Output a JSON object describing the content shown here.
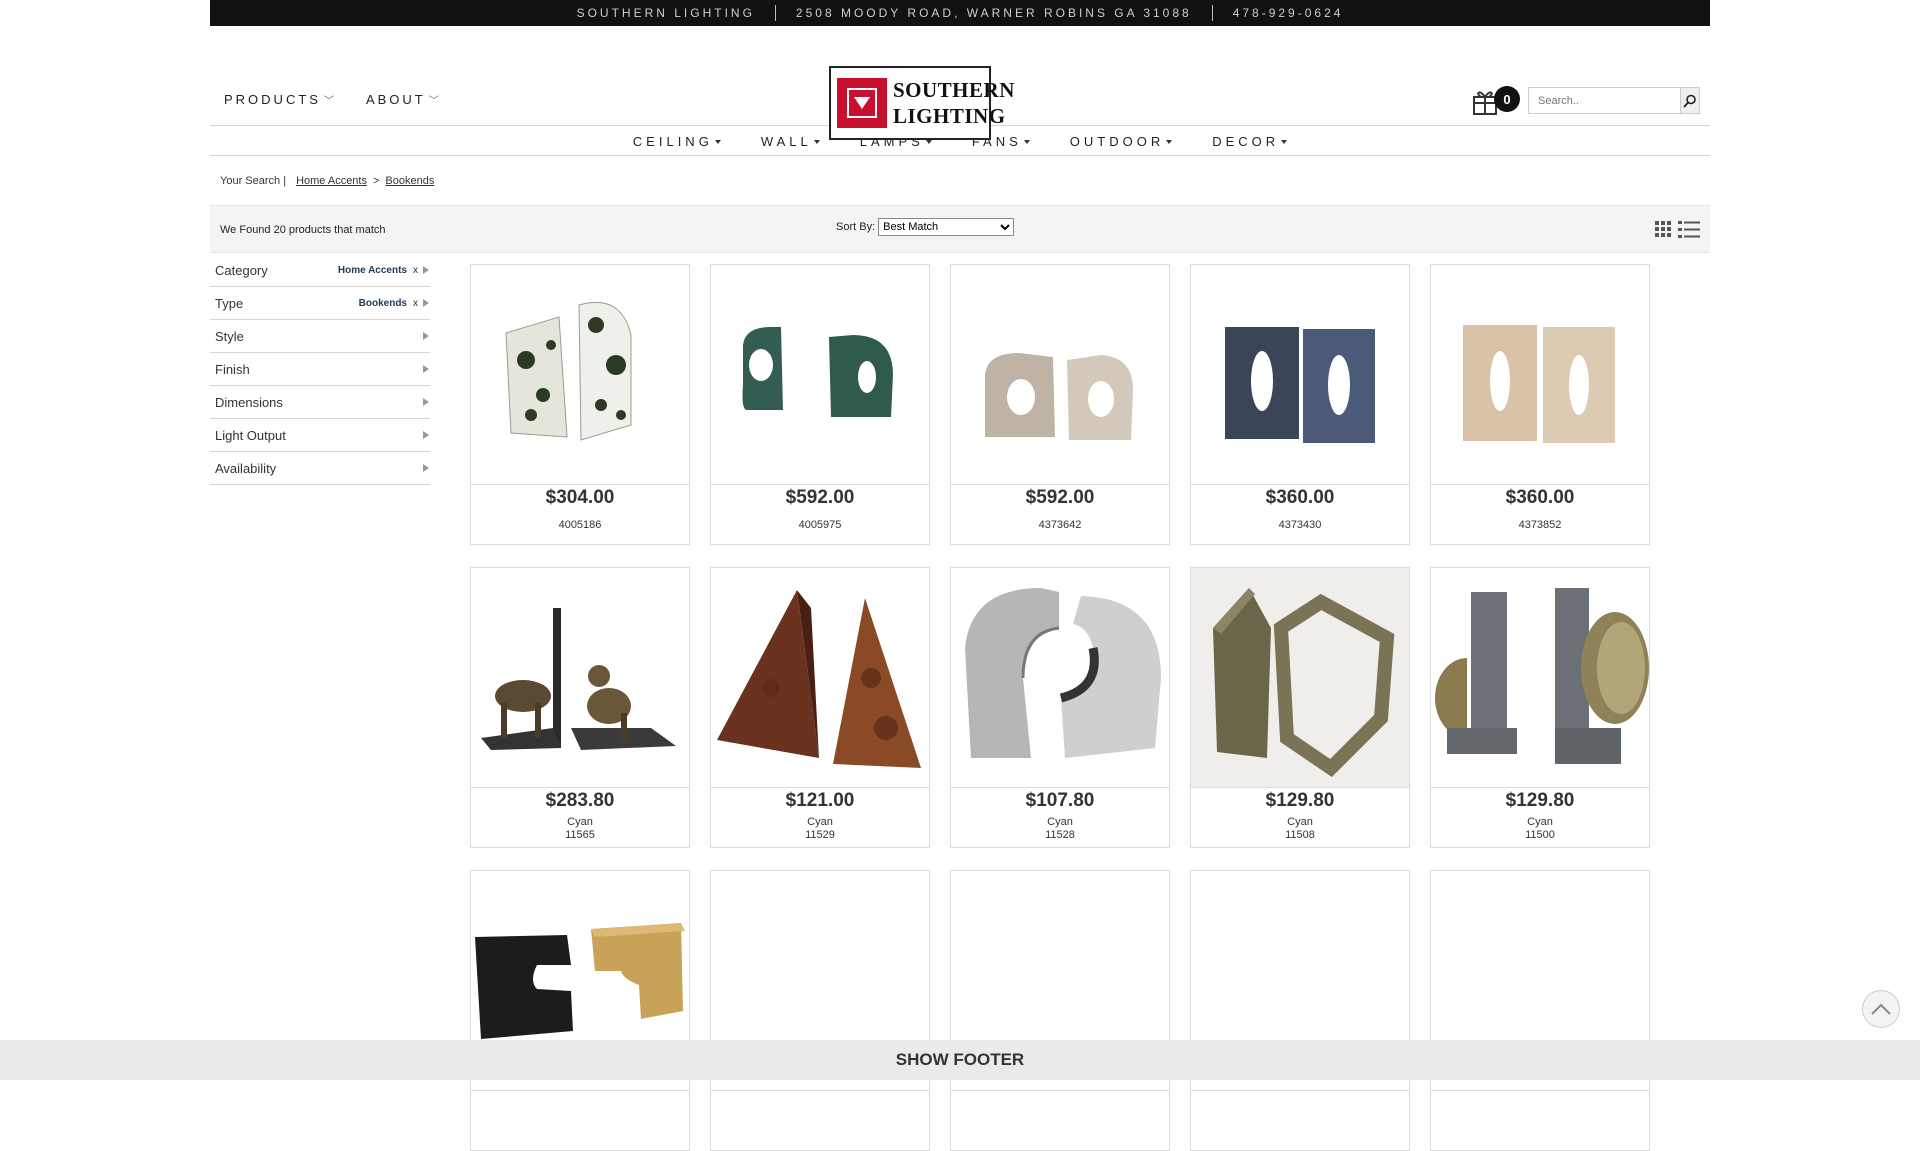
{
  "topbar": {
    "store": "SOUTHERN LIGHTING",
    "address": "2508 MOODY ROAD, WARNER ROBINS GA 31088",
    "phone": "478-929-0624"
  },
  "header": {
    "nav": [
      {
        "label": "PRODUCTS"
      },
      {
        "label": "ABOUT"
      }
    ],
    "logo_line1": "SOUTHERN",
    "logo_line2": "LIGHTING",
    "cart_count": "0",
    "search_placeholder": "Search.."
  },
  "catnav": [
    {
      "label": "CEILING"
    },
    {
      "label": "WALL"
    },
    {
      "label": "LAMPS"
    },
    {
      "label": "FANS"
    },
    {
      "label": "OUTDOOR"
    },
    {
      "label": "DECOR"
    }
  ],
  "breadcrumb": {
    "lead": "Your Search |",
    "items": [
      "Home Accents",
      "Bookends"
    ],
    "separator": ">"
  },
  "results": {
    "count_text": "We Found 20 products that match",
    "sort_label": "Sort By:",
    "sort_value": "Best Match"
  },
  "facets": [
    {
      "label": "Category",
      "selected": "Home Accents",
      "remove": "x"
    },
    {
      "label": "Type",
      "selected": "Bookends",
      "remove": "x"
    },
    {
      "label": "Style"
    },
    {
      "label": "Finish"
    },
    {
      "label": "Dimensions"
    },
    {
      "label": "Light Output"
    },
    {
      "label": "Availability"
    }
  ],
  "products": [
    {
      "price": "$304.00",
      "sku": "4005186",
      "image": "marble-bookends"
    },
    {
      "price": "$592.00",
      "sku": "4005975",
      "image": "green-marble-bookends"
    },
    {
      "price": "$592.00",
      "sku": "4373642",
      "image": "travertine-bookends"
    },
    {
      "price": "$360.00",
      "sku": "4373430",
      "image": "blue-ceramic-bookends"
    },
    {
      "price": "$360.00",
      "sku": "4373852",
      "image": "beige-ceramic-bookends"
    },
    {
      "price": "$283.80",
      "brand": "Cyan",
      "sku": "11565",
      "image": "dog-bookends"
    },
    {
      "price": "$121.00",
      "brand": "Cyan",
      "sku": "11529",
      "image": "pyramid-bookends"
    },
    {
      "price": "$107.80",
      "brand": "Cyan",
      "sku": "11528",
      "image": "silver-arch-bookends"
    },
    {
      "price": "$129.80",
      "brand": "Cyan",
      "sku": "11508",
      "image": "bronze-hexagon-bookends"
    },
    {
      "price": "$129.80",
      "brand": "Cyan",
      "sku": "11500",
      "image": "bowl-bookends"
    },
    {
      "image": "black-gold-bookends"
    },
    {
      "image": "blank"
    },
    {
      "image": "blank"
    },
    {
      "image": "blank"
    },
    {
      "image": "blank"
    }
  ],
  "footer": {
    "label": "SHOW FOOTER"
  }
}
